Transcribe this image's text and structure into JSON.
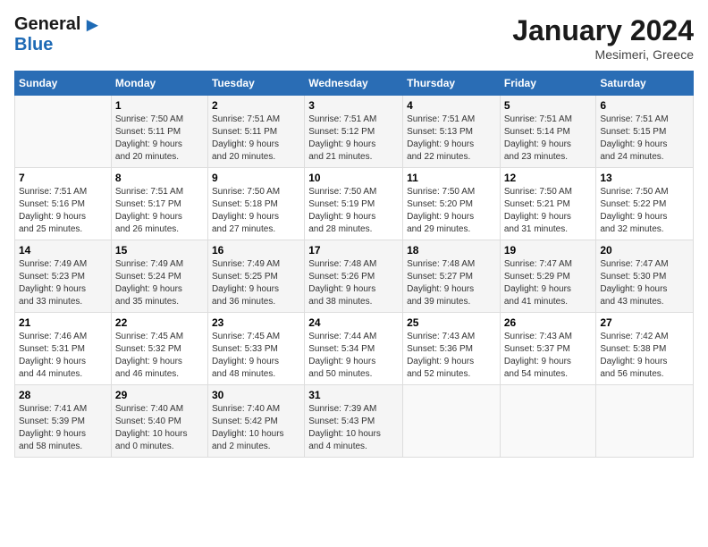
{
  "header": {
    "logo_general": "General",
    "logo_blue": "Blue",
    "month": "January 2024",
    "location": "Mesimeri, Greece"
  },
  "columns": [
    "Sunday",
    "Monday",
    "Tuesday",
    "Wednesday",
    "Thursday",
    "Friday",
    "Saturday"
  ],
  "weeks": [
    [
      {
        "day": "",
        "info": ""
      },
      {
        "day": "1",
        "info": "Sunrise: 7:50 AM\nSunset: 5:11 PM\nDaylight: 9 hours\nand 20 minutes."
      },
      {
        "day": "2",
        "info": "Sunrise: 7:51 AM\nSunset: 5:11 PM\nDaylight: 9 hours\nand 20 minutes."
      },
      {
        "day": "3",
        "info": "Sunrise: 7:51 AM\nSunset: 5:12 PM\nDaylight: 9 hours\nand 21 minutes."
      },
      {
        "day": "4",
        "info": "Sunrise: 7:51 AM\nSunset: 5:13 PM\nDaylight: 9 hours\nand 22 minutes."
      },
      {
        "day": "5",
        "info": "Sunrise: 7:51 AM\nSunset: 5:14 PM\nDaylight: 9 hours\nand 23 minutes."
      },
      {
        "day": "6",
        "info": "Sunrise: 7:51 AM\nSunset: 5:15 PM\nDaylight: 9 hours\nand 24 minutes."
      }
    ],
    [
      {
        "day": "7",
        "info": "Sunrise: 7:51 AM\nSunset: 5:16 PM\nDaylight: 9 hours\nand 25 minutes."
      },
      {
        "day": "8",
        "info": "Sunrise: 7:51 AM\nSunset: 5:17 PM\nDaylight: 9 hours\nand 26 minutes."
      },
      {
        "day": "9",
        "info": "Sunrise: 7:50 AM\nSunset: 5:18 PM\nDaylight: 9 hours\nand 27 minutes."
      },
      {
        "day": "10",
        "info": "Sunrise: 7:50 AM\nSunset: 5:19 PM\nDaylight: 9 hours\nand 28 minutes."
      },
      {
        "day": "11",
        "info": "Sunrise: 7:50 AM\nSunset: 5:20 PM\nDaylight: 9 hours\nand 29 minutes."
      },
      {
        "day": "12",
        "info": "Sunrise: 7:50 AM\nSunset: 5:21 PM\nDaylight: 9 hours\nand 31 minutes."
      },
      {
        "day": "13",
        "info": "Sunrise: 7:50 AM\nSunset: 5:22 PM\nDaylight: 9 hours\nand 32 minutes."
      }
    ],
    [
      {
        "day": "14",
        "info": "Sunrise: 7:49 AM\nSunset: 5:23 PM\nDaylight: 9 hours\nand 33 minutes."
      },
      {
        "day": "15",
        "info": "Sunrise: 7:49 AM\nSunset: 5:24 PM\nDaylight: 9 hours\nand 35 minutes."
      },
      {
        "day": "16",
        "info": "Sunrise: 7:49 AM\nSunset: 5:25 PM\nDaylight: 9 hours\nand 36 minutes."
      },
      {
        "day": "17",
        "info": "Sunrise: 7:48 AM\nSunset: 5:26 PM\nDaylight: 9 hours\nand 38 minutes."
      },
      {
        "day": "18",
        "info": "Sunrise: 7:48 AM\nSunset: 5:27 PM\nDaylight: 9 hours\nand 39 minutes."
      },
      {
        "day": "19",
        "info": "Sunrise: 7:47 AM\nSunset: 5:29 PM\nDaylight: 9 hours\nand 41 minutes."
      },
      {
        "day": "20",
        "info": "Sunrise: 7:47 AM\nSunset: 5:30 PM\nDaylight: 9 hours\nand 43 minutes."
      }
    ],
    [
      {
        "day": "21",
        "info": "Sunrise: 7:46 AM\nSunset: 5:31 PM\nDaylight: 9 hours\nand 44 minutes."
      },
      {
        "day": "22",
        "info": "Sunrise: 7:45 AM\nSunset: 5:32 PM\nDaylight: 9 hours\nand 46 minutes."
      },
      {
        "day": "23",
        "info": "Sunrise: 7:45 AM\nSunset: 5:33 PM\nDaylight: 9 hours\nand 48 minutes."
      },
      {
        "day": "24",
        "info": "Sunrise: 7:44 AM\nSunset: 5:34 PM\nDaylight: 9 hours\nand 50 minutes."
      },
      {
        "day": "25",
        "info": "Sunrise: 7:43 AM\nSunset: 5:36 PM\nDaylight: 9 hours\nand 52 minutes."
      },
      {
        "day": "26",
        "info": "Sunrise: 7:43 AM\nSunset: 5:37 PM\nDaylight: 9 hours\nand 54 minutes."
      },
      {
        "day": "27",
        "info": "Sunrise: 7:42 AM\nSunset: 5:38 PM\nDaylight: 9 hours\nand 56 minutes."
      }
    ],
    [
      {
        "day": "28",
        "info": "Sunrise: 7:41 AM\nSunset: 5:39 PM\nDaylight: 9 hours\nand 58 minutes."
      },
      {
        "day": "29",
        "info": "Sunrise: 7:40 AM\nSunset: 5:40 PM\nDaylight: 10 hours\nand 0 minutes."
      },
      {
        "day": "30",
        "info": "Sunrise: 7:40 AM\nSunset: 5:42 PM\nDaylight: 10 hours\nand 2 minutes."
      },
      {
        "day": "31",
        "info": "Sunrise: 7:39 AM\nSunset: 5:43 PM\nDaylight: 10 hours\nand 4 minutes."
      },
      {
        "day": "",
        "info": ""
      },
      {
        "day": "",
        "info": ""
      },
      {
        "day": "",
        "info": ""
      }
    ]
  ]
}
